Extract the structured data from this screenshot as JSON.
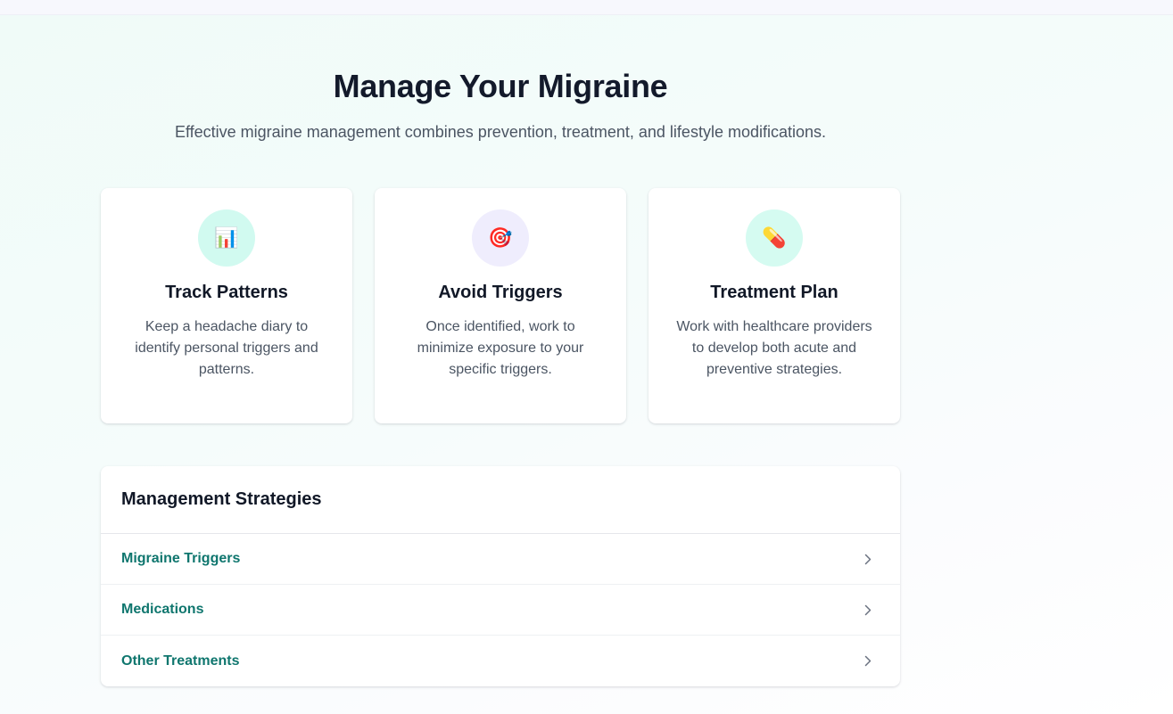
{
  "header": {
    "title": "Manage Your Migraine",
    "subtitle": "Effective migraine management combines prevention, treatment, and lifestyle modifications."
  },
  "cards": [
    {
      "icon": "bar-chart-icon",
      "glyph": "📊",
      "icon_bg": "#d1faf0",
      "title": "Track Patterns",
      "text": "Keep a headache diary to identify personal triggers and patterns."
    },
    {
      "icon": "target-icon",
      "glyph": "🎯",
      "icon_bg": "#efedfd",
      "title": "Avoid Triggers",
      "text": "Once identified, work to minimize exposure to your specific triggers."
    },
    {
      "icon": "pill-icon",
      "glyph": "💊",
      "icon_bg": "#d5fbf1",
      "title": "Treatment Plan",
      "text": "Work with healthcare providers to develop both acute and preventive strategies."
    }
  ],
  "strategies": {
    "title": "Management Strategies",
    "items": [
      {
        "label": "Migraine Triggers",
        "icon": "chevron-right-icon"
      },
      {
        "label": "Medications",
        "icon": "chevron-right-icon"
      },
      {
        "label": "Other Treatments",
        "icon": "chevron-right-icon"
      }
    ]
  },
  "colors": {
    "accent": "#0f766e",
    "title": "#131a2b",
    "body_text": "#4b5563"
  }
}
